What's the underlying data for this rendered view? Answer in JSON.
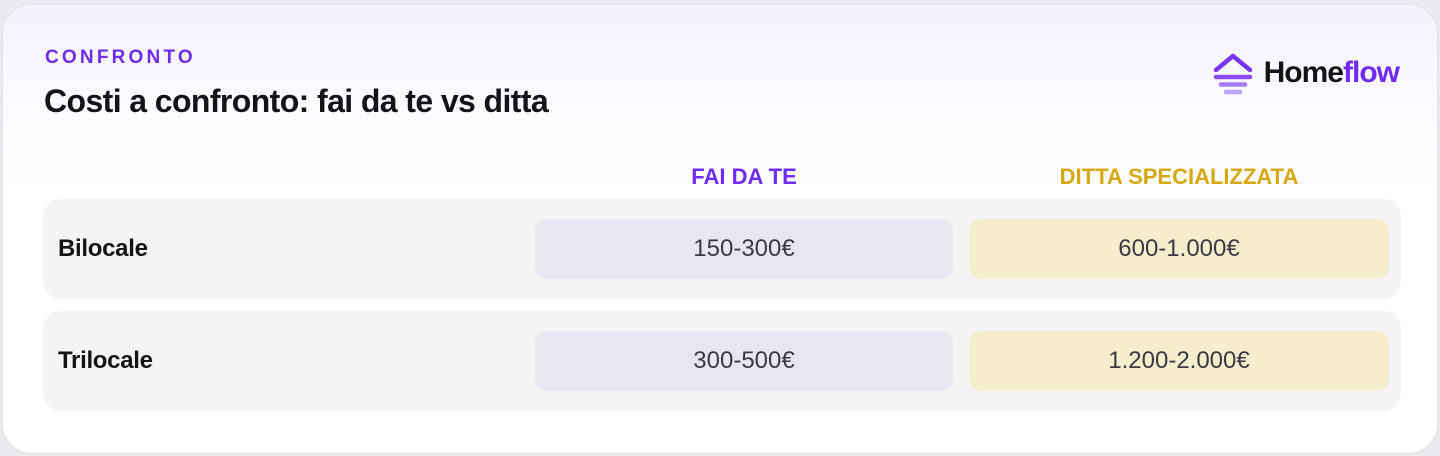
{
  "header": {
    "eyebrow": "CONFRONTO",
    "title": "Costi a confronto: fai da te vs ditta"
  },
  "brand": {
    "name_part1": "Home",
    "name_part2": "flow",
    "icon": "house-roof-icon",
    "accent_color": "#6f2cf0"
  },
  "columns": {
    "diy": "FAI DA TE",
    "pro": "DITTA SPECIALIZZATA"
  },
  "rows": [
    {
      "label": "Bilocale",
      "diy": "150-300€",
      "pro": "600-1.000€"
    },
    {
      "label": "Trilocale",
      "diy": "300-500€",
      "pro": "1.200-2.000€"
    }
  ],
  "colors": {
    "diy": "#6f2cf0",
    "pro": "#d6a814",
    "diy_cell": "#e9e6f4",
    "pro_cell": "#f6edcc"
  }
}
